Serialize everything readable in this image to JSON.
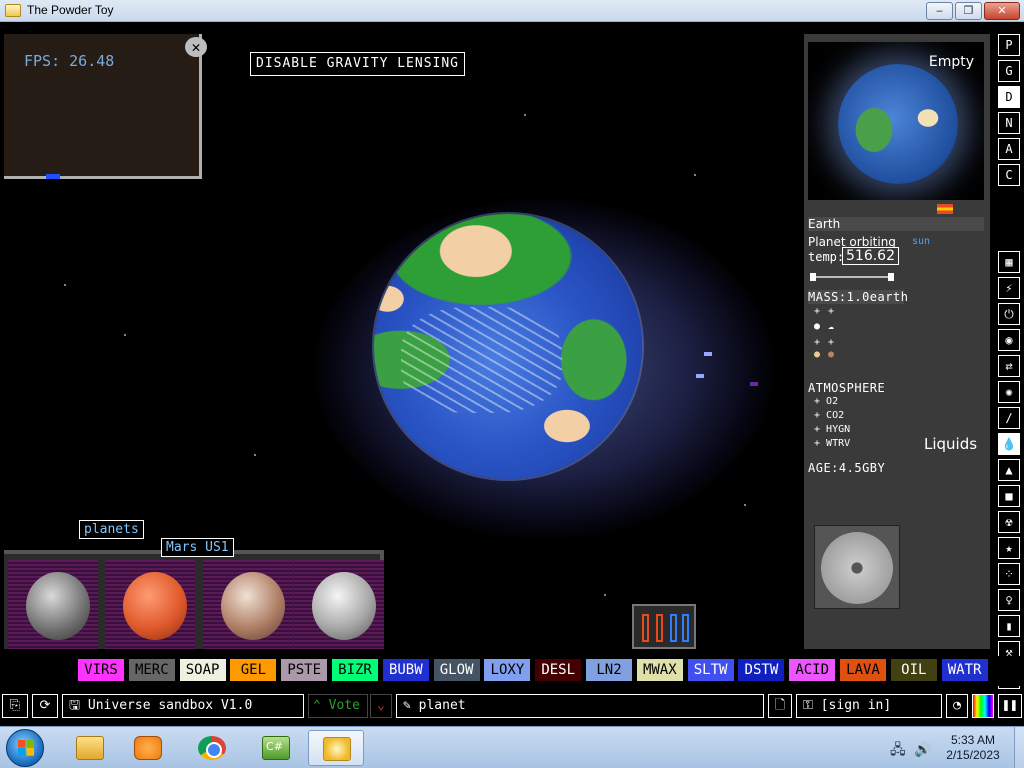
{
  "window": {
    "title": "The Powder Toy",
    "min_glyph": "‒",
    "max_glyph": "❐",
    "close_glyph": "✕"
  },
  "sim": {
    "fps": "FPS: 26.48",
    "close_glyph": "✕",
    "lensing_button": "DISABLE GRAVITY LENSING",
    "category_label": "planets",
    "hover_tooltip": "Mars US1"
  },
  "info": {
    "preview_label": "Empty",
    "planet_name": "Earth",
    "orbit_text": "Planet orbiting",
    "orbit_target": "sun",
    "temp_label": "temp:",
    "temp_value": "516.62",
    "mass": "MASS:1.0earth",
    "atmosphere_title": "ATMOSPHERE",
    "atmosphere": [
      "O2",
      "CO2",
      "HYGN",
      "WTRV"
    ],
    "age": "AGE:4.5GBY",
    "hover_category": "Liquids"
  },
  "sidebar": {
    "top": [
      "P",
      "G",
      "D",
      "N",
      "A",
      "C"
    ],
    "active_top": "D"
  },
  "elements": [
    {
      "label": "VIRS",
      "color": "#ff33ff",
      "text": "#000000"
    },
    {
      "label": "MERC",
      "color": "#666666",
      "text": "#000000"
    },
    {
      "label": "SOAP",
      "color": "#f0f0e0",
      "text": "#000000"
    },
    {
      "label": "GEL",
      "color": "#ff9900",
      "text": "#000000"
    },
    {
      "label": "PSTE",
      "color": "#aa99aa",
      "text": "#000000"
    },
    {
      "label": "BIZR",
      "color": "#00ff77",
      "text": "#000000"
    },
    {
      "label": "BUBW",
      "color": "#2030d0",
      "text": "#ffffff"
    },
    {
      "label": "GLOW",
      "color": "#445464",
      "text": "#ffffff"
    },
    {
      "label": "LOXY",
      "color": "#80a0ef",
      "text": "#000000"
    },
    {
      "label": "DESL",
      "color": "#440000",
      "text": "#ffffff"
    },
    {
      "label": "LN2",
      "color": "#80a0df",
      "text": "#000000"
    },
    {
      "label": "MWAX",
      "color": "#e0e0aa",
      "text": "#000000"
    },
    {
      "label": "SLTW",
      "color": "#4050f0",
      "text": "#ffffff"
    },
    {
      "label": "DSTW",
      "color": "#1020c0",
      "text": "#ffffff"
    },
    {
      "label": "ACID",
      "color": "#ed55ff",
      "text": "#000000"
    },
    {
      "label": "LAVA",
      "color": "#e05010",
      "text": "#000000"
    },
    {
      "label": "OIL",
      "color": "#404010",
      "text": "#ffffff"
    },
    {
      "label": "WATR",
      "color": "#2030d0",
      "text": "#ffffff"
    }
  ],
  "bottombar": {
    "save_title": "Universe sandbox V1.0",
    "vote_label": "Vote",
    "tags": "planet",
    "sign_in": "[sign in]"
  },
  "taskbar": {
    "time": "5:33 AM",
    "date": "2/15/2023",
    "csharp_label": "C#"
  }
}
